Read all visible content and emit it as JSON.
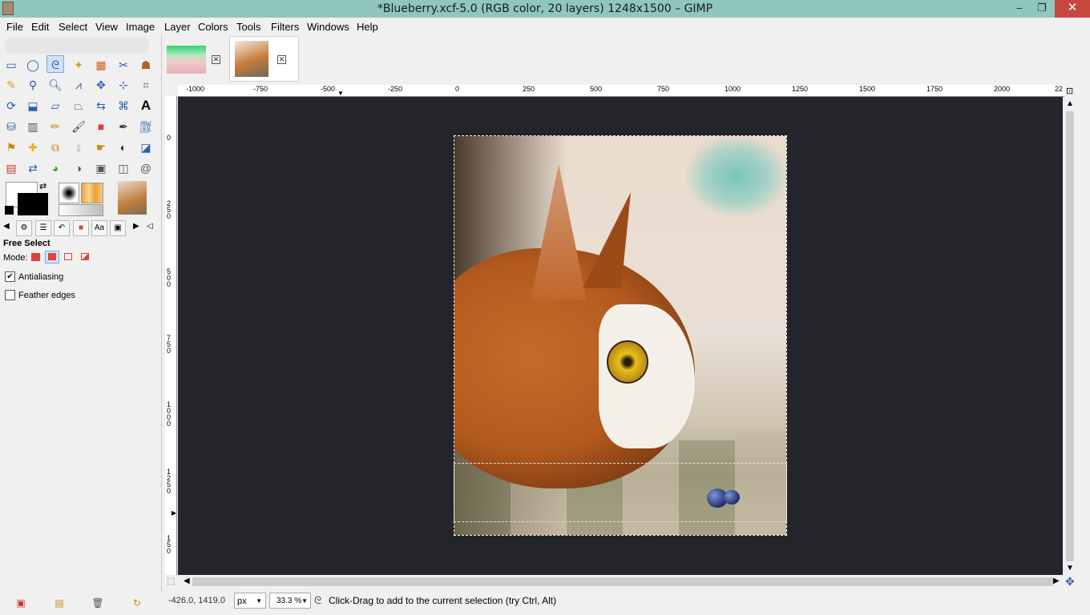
{
  "window": {
    "title": "*Blueberry.xcf-5.0 (RGB color, 20 layers) 1248x1500 – GIMP",
    "minimize": "–",
    "restore": "❐",
    "close": "✕"
  },
  "menu": [
    "File",
    "Edit",
    "Select",
    "View",
    "Image",
    "Layer",
    "Colors",
    "Tools",
    "Filters",
    "Windows",
    "Help"
  ],
  "toolbox": {
    "tool_options_title": "Free Select",
    "mode_label": "Mode:",
    "antialiasing_label": "Antialiasing",
    "antialiasing_checked": true,
    "feather_label": "Feather edges",
    "feather_checked": false
  },
  "ruler": {
    "h_labels": [
      "-1000",
      "-750",
      "-500",
      "-250",
      "0",
      "250",
      "500",
      "750",
      "1000",
      "1250",
      "1500",
      "1750",
      "2000",
      "22"
    ],
    "v_labels": [
      "0",
      "2\n5\n0",
      "5\n0\n0",
      "7\n5\n0",
      "1\n0\n0\n0",
      "1\n2\n5\n0",
      "1\n5\n0"
    ]
  },
  "status": {
    "coords": "-426.0, 1419.0",
    "unit": "px",
    "zoom": "33.3 %",
    "message": "Click-Drag to add to the current selection (try Ctrl, Alt)"
  },
  "colors": {
    "titlebar": "#8fc6bf",
    "canvas_bg": "#24242b",
    "close_button": "#c9463d"
  },
  "icons": [
    "gimp-app-icon",
    "free-select-icon",
    "status-lasso-icon"
  ]
}
